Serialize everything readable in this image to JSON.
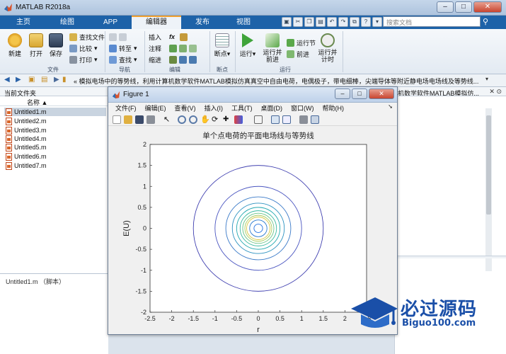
{
  "window": {
    "title": "MATLAB R2018a",
    "buttons": [
      "–",
      "□",
      "✕"
    ]
  },
  "tabs": [
    {
      "label": "主页",
      "active": false
    },
    {
      "label": "绘图",
      "active": false
    },
    {
      "label": "APP",
      "active": false
    },
    {
      "label": "编辑器",
      "active": true
    },
    {
      "label": "发布",
      "active": false
    },
    {
      "label": "视图",
      "active": false
    }
  ],
  "search": {
    "placeholder": "搜索文档"
  },
  "ribbon": {
    "file": {
      "new": "新建",
      "open": "打开",
      "save": "保存",
      "find_files": "查找文件",
      "compare": "比较",
      "print": "打印",
      "section": "文件"
    },
    "navigate": {
      "goto": "转至",
      "find": "查找",
      "section": "导航"
    },
    "edit": {
      "insert": "插入",
      "comment": "注释",
      "indent": "缩进",
      "fx": "fx",
      "section": "编辑"
    },
    "breakpoints": {
      "label": "断点",
      "section": "断点"
    },
    "run": {
      "run": "运行",
      "run_advance": "运行并前进",
      "run_section": "运行节",
      "advance": "前进",
      "run_time": "运行并计时",
      "section": "运行"
    }
  },
  "address": {
    "path": "« 模拟电场中的等势线，利用计算机数学软件MATLAB模拟仿真真空中自由电荷，电偶极子，带电细棒，尖端导体等附近静电场电场线及等势线..."
  },
  "current_folder": {
    "title": "当前文件夹",
    "column": "名称 ▲",
    "files": [
      "Untitled1.m",
      "Untitled2.m",
      "Untitled3.m",
      "Untitled4.m",
      "Untitled5.m",
      "Untitled6.m",
      "Untitled7.m"
    ],
    "selected_index": 0,
    "detail": "Untitled1.m （脚本）"
  },
  "right_panel": {
    "header": "机数学软件MATLAB模拟仿..."
  },
  "figure": {
    "title": "Figure 1",
    "menu": [
      "文件(F)",
      "编辑(E)",
      "查看(V)",
      "插入(I)",
      "工具(T)",
      "桌面(D)",
      "窗口(W)",
      "帮助(H)"
    ]
  },
  "chart_data": {
    "type": "contour",
    "title": "单个点电荷的平面电场线与等势线",
    "xlabel": "r",
    "ylabel": "E(U)",
    "xlim": [
      -2.5,
      2.5
    ],
    "ylim": [
      -2,
      2
    ],
    "xticks": [
      "-2.5",
      "-2",
      "-1.5",
      "-1",
      "-0.5",
      "0",
      "0.5",
      "1",
      "1.5",
      "2",
      "2.5"
    ],
    "yticks": [
      "2",
      "1.5",
      "1",
      "0.5",
      "0",
      "-0.5",
      "-1",
      "-1.5",
      "-2"
    ],
    "center": [
      0,
      0
    ],
    "contours": [
      {
        "radius": 1.5,
        "color": "#4040b0"
      },
      {
        "radius": 1.0,
        "color": "#4a55c0"
      },
      {
        "radius": 0.75,
        "color": "#3a7ac8"
      },
      {
        "radius": 0.6,
        "color": "#2c92c0"
      },
      {
        "radius": 0.5,
        "color": "#22a8b0"
      },
      {
        "radius": 0.42,
        "color": "#3abaa0"
      },
      {
        "radius": 0.36,
        "color": "#6cc68a"
      },
      {
        "radius": 0.31,
        "color": "#a8cc60"
      },
      {
        "radius": 0.27,
        "color": "#d8c840"
      },
      {
        "radius": 0.2,
        "color": "#2a7ad0"
      },
      {
        "radius": 0.1,
        "color": "#2070e0"
      }
    ]
  },
  "watermark": {
    "brand": "必过源码",
    "url": "Biguo100.com"
  }
}
